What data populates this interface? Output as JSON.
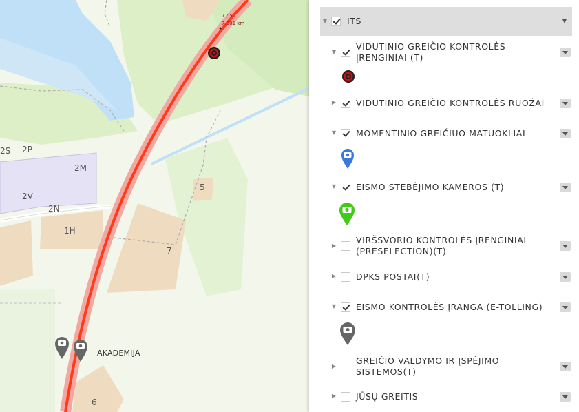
{
  "map": {
    "labels": {
      "l2s": "2S",
      "l2p": "2P",
      "l2m": "2M",
      "l2v": "2V",
      "l2n": "2N",
      "l1h": "1H",
      "l5": "5",
      "l7": "7",
      "l6": "6",
      "akademija": "AKADEMIJA",
      "measure_line1": "7 / 50",
      "measure_line2": "7,001 km"
    }
  },
  "panel": {
    "root": {
      "label": "ITS",
      "checked": true
    },
    "layers": [
      {
        "label": "VIDUTINIO GREIČIO KONTROLĖS\nĮRENGINIAI (T)",
        "checked": true,
        "expanded": true,
        "icon": "average-speed-target-icon"
      },
      {
        "label": "VIDUTINIO GREIČIO KONTROLĖS RUOŽAI",
        "checked": true,
        "expanded": false
      },
      {
        "label": "MOMENTINIO GREIČIUO MATUOKLIAI",
        "checked": true,
        "expanded": true,
        "icon": "blue-camera-pin-icon"
      },
      {
        "label": "EISMO STEBĖJIMO KAMEROS (T)",
        "checked": true,
        "expanded": true,
        "icon": "green-camera-pin-icon"
      },
      {
        "label": "VIRŠSVORIO KONTROLĖS ĮRENGINIAI\n(PRESELECTION)(T)",
        "checked": false,
        "expanded": false
      },
      {
        "label": "DPKS POSTAI(T)",
        "checked": false,
        "expanded": false
      },
      {
        "label": "EISMO KONTROLĖS ĮRANGA (E-TOLLING)",
        "checked": true,
        "expanded": true,
        "icon": "grey-camera-pin-icon"
      },
      {
        "label": "GREIČIO VALDYMO IR ĮSPĖJIMO\nSISTEMOS(T)",
        "checked": false,
        "expanded": false
      },
      {
        "label": "JŪSŲ GREITIS",
        "checked": false,
        "expanded": false
      }
    ]
  },
  "colors": {
    "road_fill": "#f2a8a2",
    "road_line": "#ff3b1a",
    "water": "#bfe0f6",
    "grass": "#dcefc7",
    "building": "#efdcc0",
    "residential": "#e6e2f5",
    "pin_blue": "#3a78e0",
    "pin_green": "#3ecc14",
    "pin_grey": "#666666",
    "target_red": "#cc1111"
  }
}
